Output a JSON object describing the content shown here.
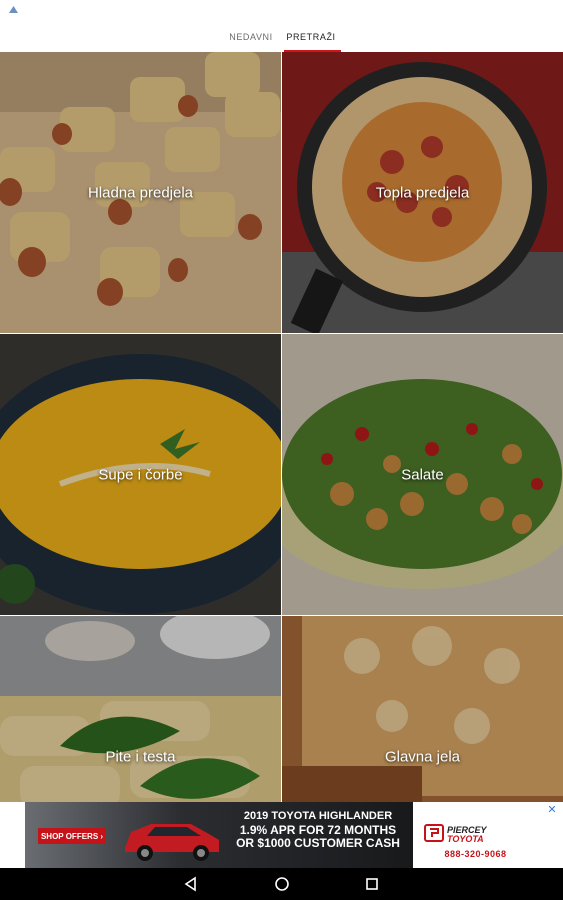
{
  "tabs": [
    {
      "label": "NEDAVNI",
      "active": false
    },
    {
      "label": "PRETRAŽI",
      "active": true
    }
  ],
  "accent_color": "#d0161a",
  "categories": [
    {
      "label": "Hladna predjela"
    },
    {
      "label": "Topla predjela"
    },
    {
      "label": "Supe i čorbe"
    },
    {
      "label": "Salate"
    },
    {
      "label": "Pite i testa"
    },
    {
      "label": "Glavna jela"
    }
  ],
  "ad": {
    "headline": "2019 TOYOTA HIGHLANDER",
    "line1": "1.9% APR FOR 72 MONTHS",
    "line2": "OR $1000 CUSTOMER CASH",
    "button": "SHOP OFFERS ›",
    "brand": "PIERCEY TOYOTA",
    "phone": "888-320-9068",
    "close_icon": "ad-choices-icon"
  },
  "navbar": {
    "back_icon": "back-triangle-icon",
    "home_icon": "home-circle-icon",
    "recents_icon": "recents-square-icon"
  }
}
